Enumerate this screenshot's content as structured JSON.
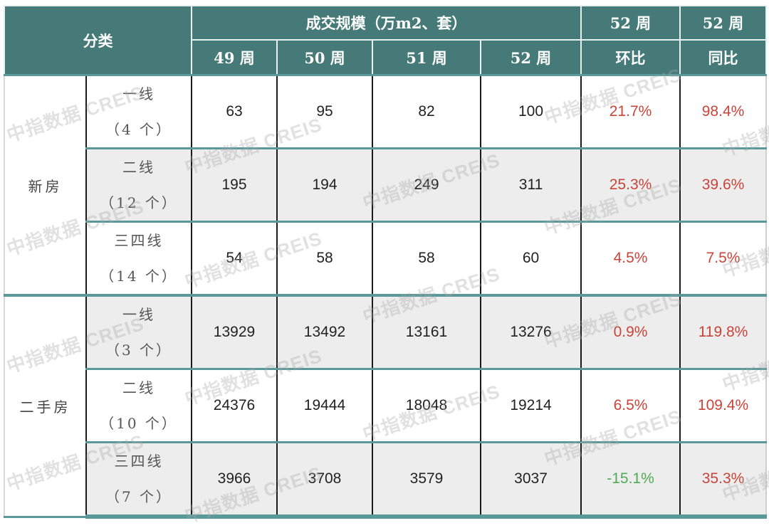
{
  "header": {
    "category": "分类",
    "volume_group": "成交规模（万m2、套）",
    "weeks": [
      "49 周",
      "50 周",
      "51 周",
      "52 周"
    ],
    "mom_top": "52 周",
    "mom_bottom": "环比",
    "yoy_top": "52 周",
    "yoy_bottom": "同比"
  },
  "groups": [
    {
      "name": "新房",
      "rows": [
        {
          "tier": "一线",
          "count": "（4 个）",
          "w49": "63",
          "w50": "95",
          "w51": "82",
          "w52": "100",
          "mom": "21.7%",
          "yoy": "98.4%"
        },
        {
          "tier": "二线",
          "count": "（12 个）",
          "w49": "195",
          "w50": "194",
          "w51": "249",
          "w52": "311",
          "mom": "25.3%",
          "yoy": "39.6%"
        },
        {
          "tier": "三四线",
          "count": "（14 个）",
          "w49": "54",
          "w50": "58",
          "w51": "58",
          "w52": "60",
          "mom": "4.5%",
          "yoy": "7.5%"
        }
      ]
    },
    {
      "name": "二手房",
      "rows": [
        {
          "tier": "一线",
          "count": "（3 个）",
          "w49": "13929",
          "w50": "13492",
          "w51": "13161",
          "w52": "13276",
          "mom": "0.9%",
          "yoy": "119.8%"
        },
        {
          "tier": "二线",
          "count": "（10 个）",
          "w49": "24376",
          "w50": "19444",
          "w51": "18048",
          "w52": "19214",
          "mom": "6.5%",
          "yoy": "109.4%"
        },
        {
          "tier": "三四线",
          "count": "（7 个）",
          "w49": "3966",
          "w50": "3708",
          "w51": "3579",
          "w52": "3037",
          "mom": "-15.1%",
          "yoy": "35.3%"
        }
      ]
    }
  ],
  "watermark": "中指数据 CREIS",
  "colors": {
    "header_bg": "#457a78",
    "positive": "#c9443a",
    "negative": "#4faa55",
    "divider": "#5a9999"
  }
}
